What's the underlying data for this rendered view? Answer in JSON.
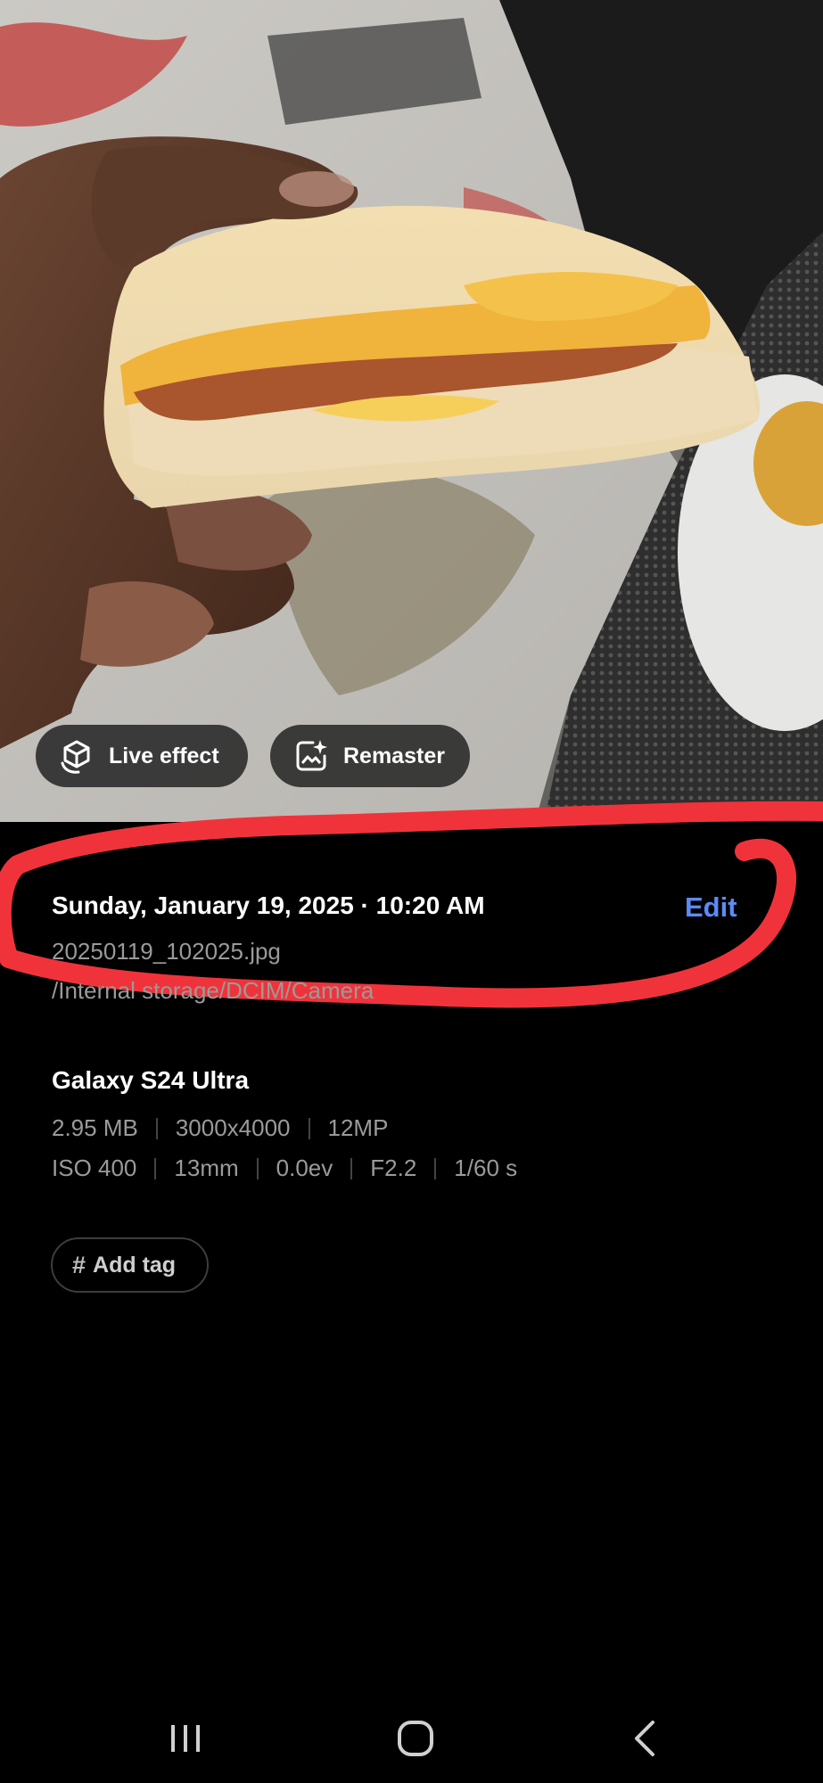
{
  "photo": {
    "live_effect_label": "Live effect",
    "remaster_label": "Remaster"
  },
  "details": {
    "datetime": "Sunday, January 19, 2025 · 10:20 AM",
    "edit_label": "Edit",
    "filename": "20250119_102025.jpg",
    "path": "/Internal storage/DCIM/Camera"
  },
  "device": {
    "model": "Galaxy S24 Ultra",
    "size": "2.95 MB",
    "resolution": "3000x4000",
    "megapixels": "12MP",
    "iso": "ISO 400",
    "focal_length": "13mm",
    "exposure_value": "0.0ev",
    "aperture": "F2.2",
    "shutter": "1/60 s"
  },
  "tags": {
    "add_tag_label": "Add tag"
  },
  "colors": {
    "accent": "#5b8bf5",
    "annotation": "#f0333a"
  },
  "navbar": {
    "recents_icon": "recents-icon",
    "home_icon": "home-icon",
    "back_icon": "back-icon"
  }
}
